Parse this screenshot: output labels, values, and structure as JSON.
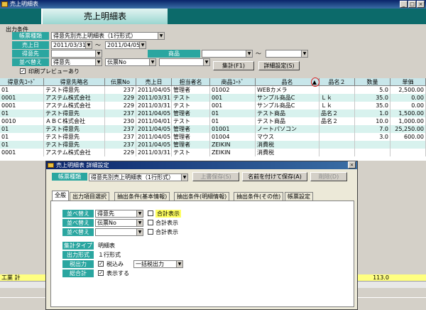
{
  "window": {
    "title": "売上明細表"
  },
  "banner": {
    "title": "売上明細表"
  },
  "filters": {
    "section_label": "出力条件",
    "report_type": {
      "label": "帳票種類",
      "value": "得意先別売上明細表（1行形式）"
    },
    "sales_date": {
      "label": "売上日",
      "from": "2011/03/31",
      "to": "2011/04/05",
      "sep": "～"
    },
    "customer": {
      "label": "得意先",
      "value": ""
    },
    "product": {
      "label": "商品",
      "from": "",
      "to": "",
      "sep": "～"
    },
    "sort": {
      "label": "並べ替え",
      "values": [
        "得意先",
        "伝票No",
        ""
      ]
    },
    "print_preview": {
      "label": "印刷プレビューあり",
      "checked": true
    },
    "aggregate_button": "集計(F1)",
    "detail_settings_button": "詳細設定(S)"
  },
  "grid": {
    "columns": [
      "得意先ｺｰﾄﾞ",
      "得意先略名",
      "伝票No",
      "売上日",
      "担当者名",
      "商品ｺｰﾄﾞ",
      "品名",
      "品名２",
      "数量",
      "単価"
    ],
    "sort_indicator": "▲",
    "rows": [
      [
        "01",
        "テスト得意先",
        "237",
        "2011/04/05",
        "管理者",
        "01002",
        "WEBカメラ",
        "",
        "5.0",
        "2,500.00"
      ],
      [
        "0001",
        "アステム株式会社",
        "229",
        "2011/03/31",
        "テスト",
        "001",
        "サンプル商品C",
        "Ｌｋ",
        "35.0",
        "0.00"
      ],
      [
        "0001",
        "アステム株式会社",
        "229",
        "2011/03/31",
        "テスト",
        "001",
        "サンプル商品C",
        "Ｌｋ",
        "35.0",
        "0.00"
      ],
      [
        "01",
        "テスト得意先",
        "237",
        "2011/04/05",
        "管理者",
        "01",
        "テスト商品",
        "品名２",
        "1.0",
        "1,500.00"
      ],
      [
        "0010",
        "ＡＢＣ株式会社",
        "230",
        "2011/04/01",
        "テスト",
        "01",
        "テスト商品",
        "品名２",
        "10.0",
        "1,000.00"
      ],
      [
        "01",
        "テスト得意先",
        "237",
        "2011/04/05",
        "管理者",
        "01001",
        "ノートパソコン",
        "",
        "7.0",
        "25,250.00"
      ],
      [
        "01",
        "テスト得意先",
        "237",
        "2011/04/05",
        "管理者",
        "01004",
        "マウス",
        "",
        "3.0",
        "600.00"
      ],
      [
        "01",
        "テスト得意先",
        "237",
        "2011/04/05",
        "管理者",
        "ZEIKIN",
        "消費税",
        "",
        "",
        ""
      ],
      [
        "0001",
        "アステム株式会社",
        "229",
        "2011/03/31",
        "テスト",
        "ZEIKIN",
        "消費税",
        "",
        "",
        ""
      ]
    ]
  },
  "totals": {
    "label": "工業 計",
    "quantity": "113.0"
  },
  "dialog": {
    "title": "売上明細表 詳細設定",
    "report_type_label": "帳票種類",
    "report_type_value": "得意先別売上明細表（1行形式）",
    "buttons": {
      "overwrite": "上書保存(S)",
      "save_as": "名前を付けて保存(A)",
      "delete": "削除(D)"
    },
    "tabs": [
      "全般",
      "出力項目選択",
      "抽出条件(基本情報)",
      "抽出条件(明細情報)",
      "抽出条件(その他)",
      "帳票設定"
    ],
    "sort_rows": [
      {
        "label": "並べ替え",
        "value": "得意先",
        "subtotal_label": "合計表示",
        "highlight": true
      },
      {
        "label": "並べ替え",
        "value": "伝票No",
        "subtotal_label": "合計表示",
        "highlight": false
      },
      {
        "label": "並べ替え",
        "value": "",
        "subtotal_label": "合計表示",
        "highlight": false
      }
    ],
    "agg_type": {
      "label": "集計タイプ",
      "value": "明細表"
    },
    "output_format": {
      "label": "出力形式",
      "value": "１行形式"
    },
    "tax_output": {
      "label": "税出力",
      "checkbox_label": "税込み",
      "value": "一括税出力"
    },
    "grand_total": {
      "label": "総合計",
      "checkbox_label": "表示する"
    }
  },
  "colors": {
    "teal": "#2aa6a0",
    "banner_bg": "#0c6a6a",
    "row_alt": "#d8f2ee",
    "totals_bg": "#ffff80"
  }
}
